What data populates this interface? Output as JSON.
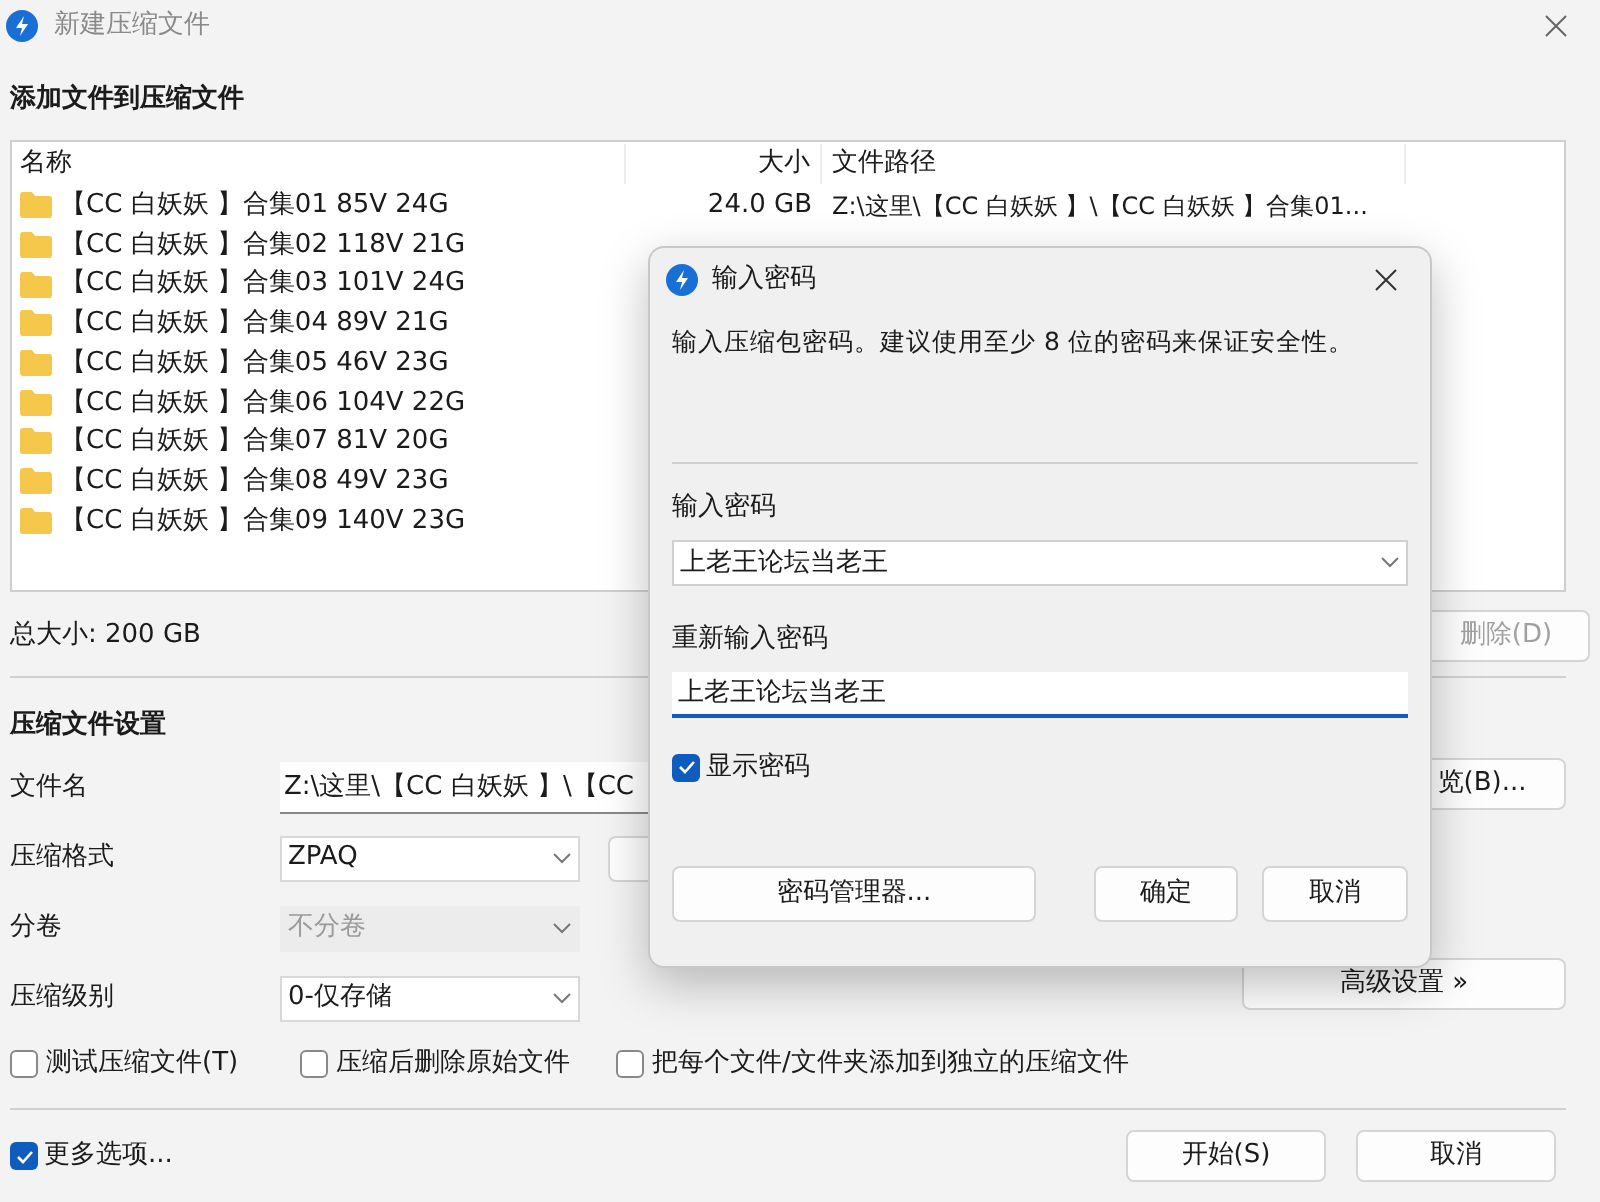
{
  "window": {
    "title": "新建压缩文件"
  },
  "add_section": {
    "heading": "添加文件到压缩文件"
  },
  "file_list": {
    "columns": [
      "名称",
      "大小",
      "文件路径"
    ],
    "rows": [
      {
        "name": "【CC 白妖妖 】合集01 85V 24G",
        "size": "24.0 GB",
        "path": "Z:\\这里\\【CC 白妖妖 】\\【CC 白妖妖 】合集01..."
      },
      {
        "name": "【CC 白妖妖 】合集02 118V 21G"
      },
      {
        "name": "【CC 白妖妖 】合集03 101V 24G"
      },
      {
        "name": "【CC 白妖妖 】合集04 89V 21G"
      },
      {
        "name": "【CC 白妖妖 】合集05 46V 23G"
      },
      {
        "name": "【CC 白妖妖 】合集06 104V 22G"
      },
      {
        "name": "【CC 白妖妖 】合集07 81V 20G"
      },
      {
        "name": "【CC 白妖妖 】合集08 49V 23G"
      },
      {
        "name": "【CC 白妖妖 】合集09 140V 23G"
      }
    ]
  },
  "total_size": "总大小: 200 GB",
  "delete_button": {
    "label": "删除(D)",
    "disabled": true
  },
  "settings": {
    "heading": "压缩文件设置",
    "fields": [
      {
        "kind": "text",
        "label": "文件名",
        "value": "Z:\\这里\\【CC 白妖妖 】\\【CC",
        "button": "览(B)..."
      },
      {
        "kind": "select",
        "label": "压缩格式",
        "value": "ZPAQ",
        "disabled": false
      },
      {
        "kind": "select",
        "label": "分卷",
        "value": "不分卷",
        "disabled": true
      },
      {
        "kind": "select",
        "label": "压缩级别",
        "value": "0-仅存储",
        "disabled": false,
        "button": "高级设置 »"
      }
    ],
    "options": [
      {
        "label": "测试压缩文件(T)",
        "checked": false
      },
      {
        "label": "压缩后删除原始文件",
        "checked": false
      },
      {
        "label": "把每个文件/文件夹添加到独立的压缩文件",
        "checked": false
      }
    ]
  },
  "more_options": {
    "label": "更多选项...",
    "checked": true
  },
  "buttons": [
    "开始(S)",
    "取消"
  ],
  "dialog": {
    "title": "输入密码",
    "message": "输入压缩包密码。建议使用至少 8 位的密码来保证安全性。",
    "password_label": "输入密码",
    "password": "上老王论坛当老王",
    "confirm_label": "重新输入密码",
    "confirm": "上老王论坛当老王",
    "show_password": {
      "label": "显示密码",
      "checked": true
    },
    "buttons": [
      "密码管理器...",
      "确定",
      "取消"
    ]
  }
}
